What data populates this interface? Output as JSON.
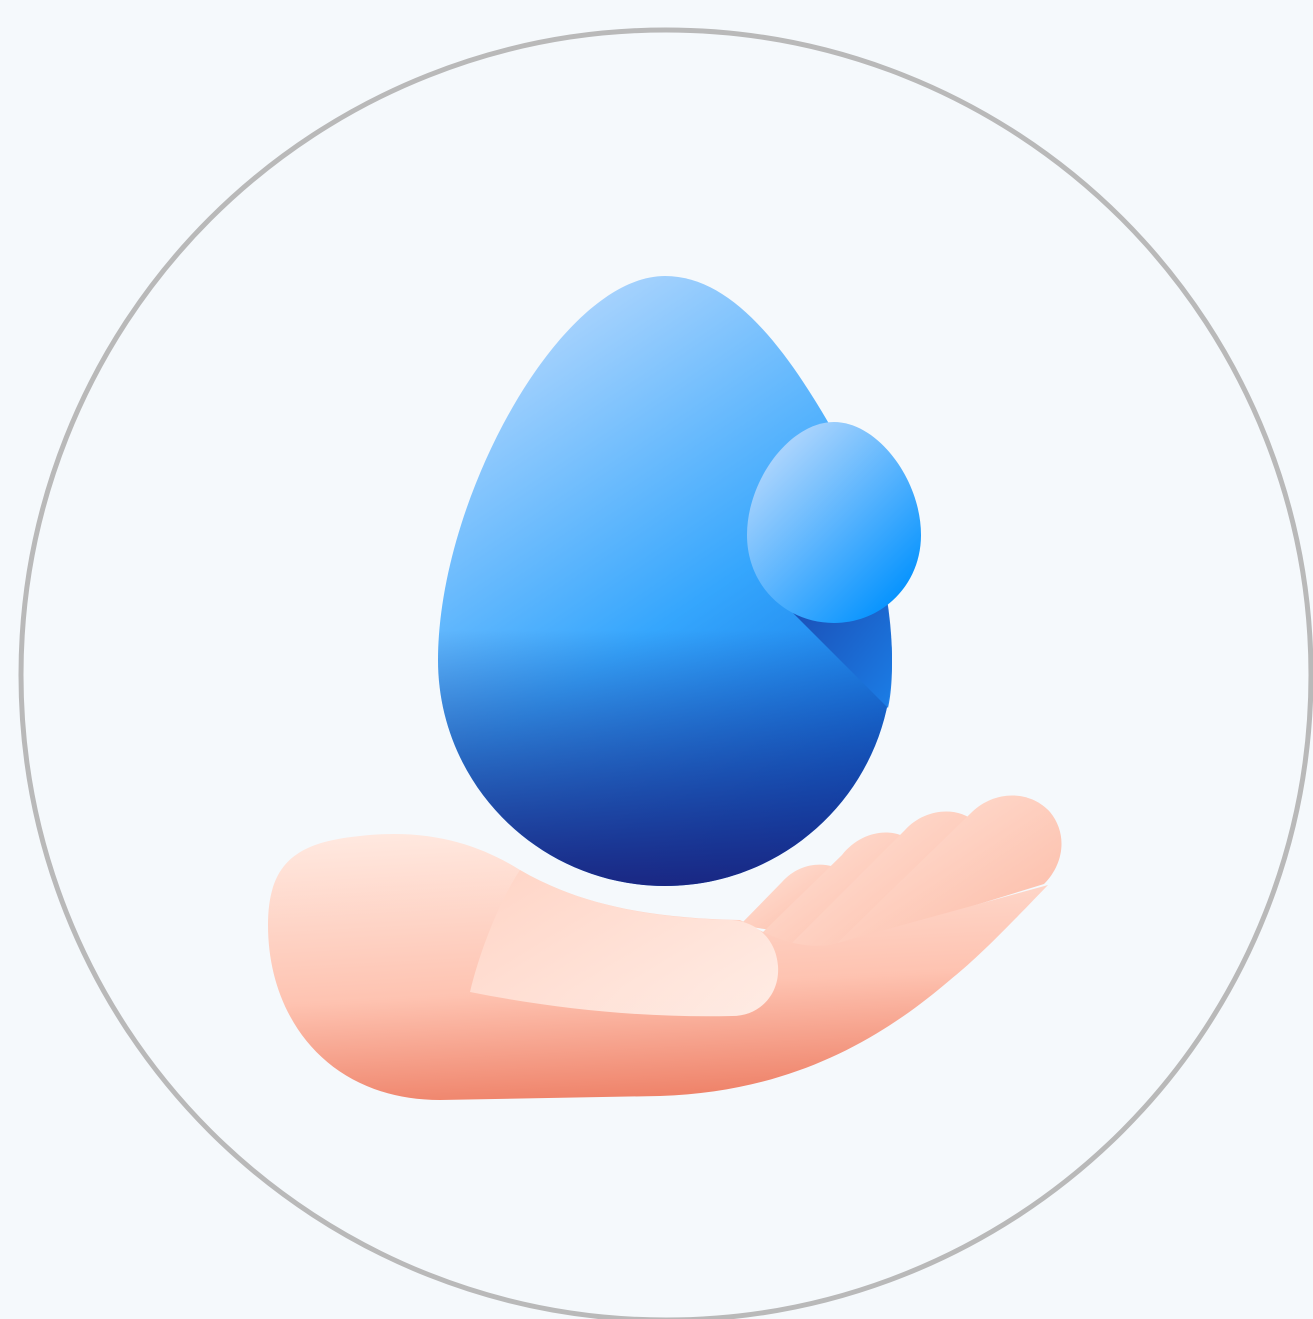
{
  "illustration": {
    "icon": "water-drop-in-hand-icon",
    "colors": {
      "background": "#f5f9fc",
      "ring": "#b9b9b9",
      "drop_light": "#a8d3fd",
      "drop_mid": "#35a6fd",
      "drop_dark": "#1a237e",
      "droplet_accent": "#0593fe",
      "hand_light": "#ffe8df",
      "hand_mid": "#fec3b1",
      "hand_dark": "#ef846b"
    }
  }
}
